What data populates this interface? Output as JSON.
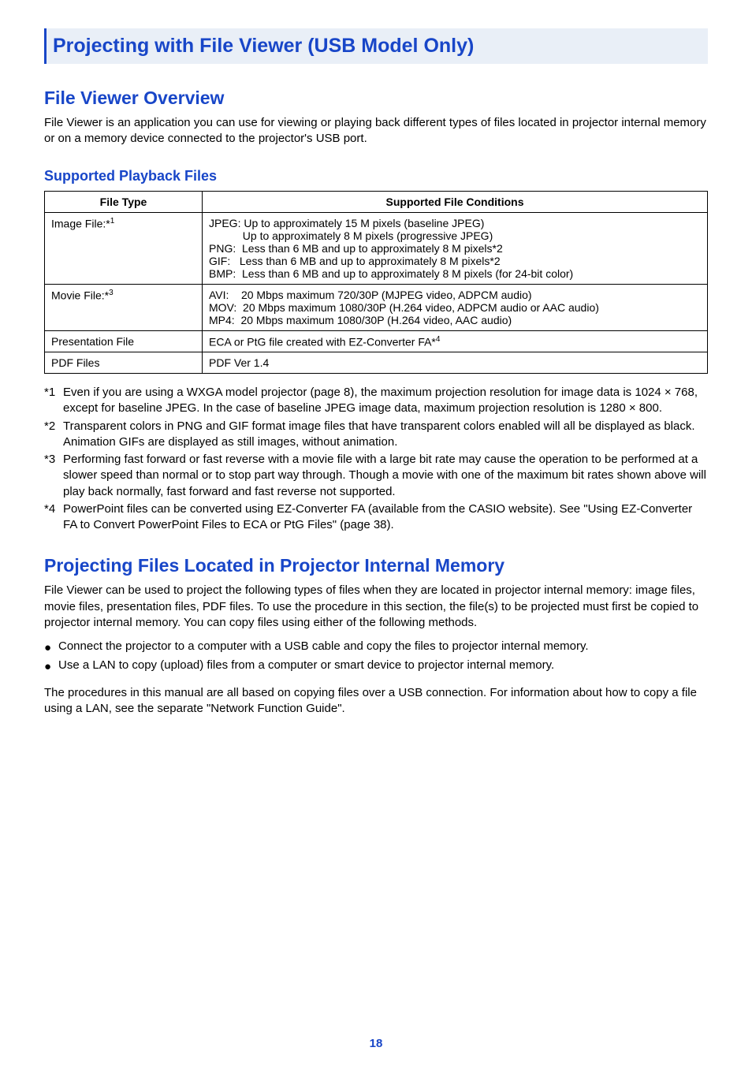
{
  "page": {
    "title": "Projecting with File Viewer (USB Model Only)",
    "pagenum": "18"
  },
  "sec1": {
    "h2": "File Viewer Overview",
    "p": "File Viewer is an application you can use for viewing or playing back different types of files located in projector internal memory or on a memory device connected to the projector's USB port."
  },
  "supported": {
    "h3": "Supported Playback Files",
    "headers": {
      "c1": "File Type",
      "c2": "Supported File Conditions"
    },
    "rows": [
      {
        "type_prefix": "Image File:*",
        "type_sup": "1",
        "cond": "JPEG: Up to approximately 15 M pixels (baseline JPEG)\n           Up to approximately 8 M pixels (progressive JPEG)\nPNG:  Less than 6 MB and up to approximately 8 M pixels*2\nGIF:   Less than 6 MB and up to approximately 8 M pixels*2\nBMP:  Less than 6 MB and up to approximately 8 M pixels (for 24-bit color)"
      },
      {
        "type_prefix": "Movie File:*",
        "type_sup": "3",
        "cond": "AVI:    20 Mbps maximum 720/30P (MJPEG video, ADPCM audio)\nMOV:  20 Mbps maximum 1080/30P (H.264 video, ADPCM audio or AAC audio)\nMP4:  20 Mbps maximum 1080/30P (H.264 video, AAC audio)"
      },
      {
        "type_prefix": "Presentation File",
        "type_sup": "",
        "cond_prefix": "ECA or PtG file created with EZ-Converter FA*",
        "cond_sup": "4"
      },
      {
        "type_prefix": "PDF Files",
        "type_sup": "",
        "cond": "PDF Ver 1.4"
      }
    ]
  },
  "notes": [
    {
      "m": "*1",
      "t": "Even if you are using a WXGA model projector (page 8), the maximum projection resolution for image data is 1024 × 768, except for baseline JPEG. In the case of baseline JPEG image data, maximum projection resolution is 1280 × 800."
    },
    {
      "m": "*2",
      "t": "Transparent colors in PNG and GIF format image files that have transparent colors enabled will all be displayed as black. Animation GIFs are displayed as still images, without animation."
    },
    {
      "m": "*3",
      "t": "Performing fast forward or fast reverse with a movie file with a large bit rate may cause the operation to be performed at a slower speed than normal or to stop part way through. Though a movie with one of the maximum bit rates shown above will play back normally, fast forward and fast reverse not supported."
    },
    {
      "m": "*4",
      "t": "PowerPoint files can be converted using EZ-Converter FA (available from the CASIO website). See \"Using EZ-Converter FA to Convert PowerPoint Files to ECA or PtG Files\" (page 38)."
    }
  ],
  "sec2": {
    "h2": "Projecting Files Located in Projector Internal Memory",
    "p1": "File Viewer can be used to project the following types of files when they are located in projector internal memory: image files, movie files, presentation files, PDF files. To use the procedure in this section, the file(s) to be projected must first be copied to projector internal memory. You can copy files using either of the following methods.",
    "bullets": [
      "Connect the projector to a computer with a USB cable and copy the files to projector internal memory.",
      "Use a LAN to copy (upload) files from a computer or smart device to projector internal memory."
    ],
    "p2": "The procedures in this manual are all based on copying files over a USB connection. For information about how to copy a file using a LAN, see the separate \"Network Function Guide\"."
  }
}
